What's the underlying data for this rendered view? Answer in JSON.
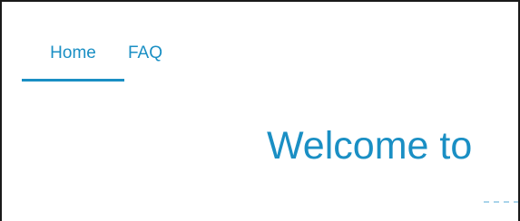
{
  "nav": {
    "tabs": [
      {
        "label": "Home",
        "active": true
      },
      {
        "label": "FAQ",
        "active": false
      }
    ]
  },
  "hero": {
    "title": "Welcome to"
  },
  "colors": {
    "accent": "#1a8fc4",
    "divider": "#a9d4ea",
    "frame_border": "#1a1a1a",
    "background": "#ffffff"
  }
}
